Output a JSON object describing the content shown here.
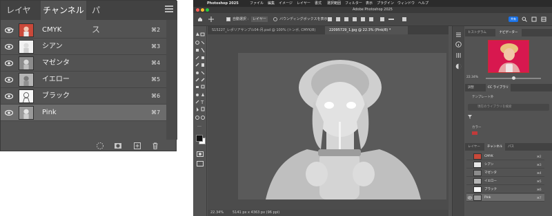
{
  "channels_panel": {
    "tabs": [
      "レイヤー",
      "チャンネル",
      "パス"
    ],
    "active_tab": 1,
    "rows": [
      {
        "name": "CMYK",
        "shortcut": "⌘2",
        "visible": true,
        "thumb": "color"
      },
      {
        "name": "シアン",
        "shortcut": "⌘3",
        "visible": true,
        "thumb": "light"
      },
      {
        "name": "マゼンタ",
        "shortcut": "⌘4",
        "visible": true,
        "thumb": "gray"
      },
      {
        "name": "イエロー",
        "shortcut": "⌘5",
        "visible": true,
        "thumb": "gray"
      },
      {
        "name": "ブラック",
        "shortcut": "⌘6",
        "visible": true,
        "thumb": "light"
      },
      {
        "name": "Pink",
        "shortcut": "⌘7",
        "visible": true,
        "thumb": "gray",
        "selected": true
      }
    ],
    "bottom_icons": [
      "load-selection-icon",
      "save-mask-icon",
      "new-channel-icon",
      "trash-icon"
    ]
  },
  "photoshop": {
    "menubar": [
      "Photoshop 2025",
      "ファイル",
      "編集",
      "イメージ",
      "レイヤー",
      "書式",
      "選択範囲",
      "フィルター",
      "表示",
      "プラグイン",
      "ウィンドウ",
      "ヘルプ"
    ],
    "window_title": "Adobe Photoshop 2025",
    "options": {
      "auto_select_label": "自動選択 :",
      "auto_select_value": "レイヤー",
      "bounding_box_label": "バウンディングボックスを表示",
      "share_label": "共有"
    },
    "doc_tabs": [
      {
        "label": "S15227_レポリアサンプル04-月.psd @ 100% (トンボ, CMYK/8)",
        "active": false
      },
      {
        "label": "22095729_1.jpg @ 22.3% (Pink/8) *",
        "active": true
      }
    ],
    "status": {
      "zoom": "22.34%",
      "size": "5141 px x 4363 px (96 ppi)"
    },
    "navigator": {
      "tabs": [
        "ヒストグラム",
        "ナビゲーター"
      ],
      "active_tab": 1,
      "zoom": "22.34%"
    },
    "libraries": {
      "tabs": [
        "調整",
        "CC ライブラリ"
      ],
      "active_tab": 1,
      "library_name": "テンプレート外",
      "search_placeholder": "現在のライブラリを検索",
      "section": "カラー"
    },
    "channels_mini": {
      "tabs": [
        "レイヤー",
        "チャンネル",
        "パス"
      ],
      "active_tab": 1,
      "rows": [
        {
          "name": "CMYK",
          "shortcut": "⌘2"
        },
        {
          "name": "シアン",
          "shortcut": "⌘3"
        },
        {
          "name": "マゼンタ",
          "shortcut": "⌘4"
        },
        {
          "name": "イエロー",
          "shortcut": "⌘5"
        },
        {
          "name": "ブラック",
          "shortcut": "⌘6"
        },
        {
          "name": "Pink",
          "shortcut": "⌘7",
          "selected": true
        }
      ]
    }
  },
  "colors": {
    "accent": "#1b73e8",
    "navigator_bg": "#d8184f",
    "panel_bg": "#535353"
  }
}
